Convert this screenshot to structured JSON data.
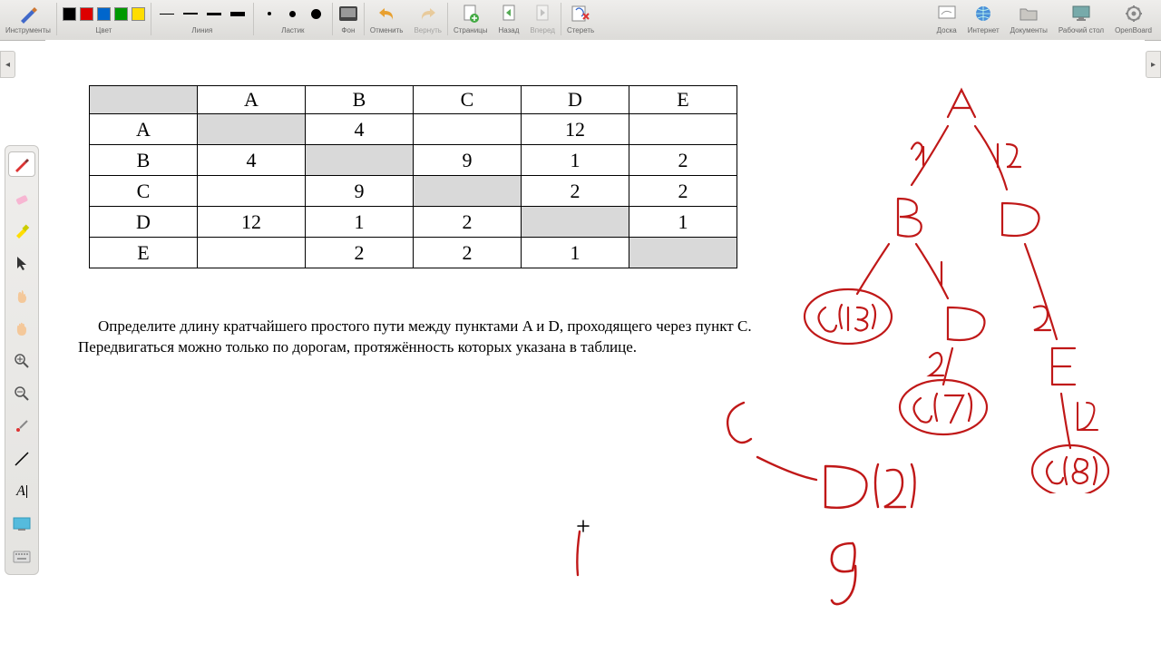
{
  "toolbar": {
    "tools_label": "Инструменты",
    "color_label": "Цвет",
    "line_label": "Линия",
    "eraser_label": "Ластик",
    "bg_label": "Фон",
    "undo_label": "Отменить",
    "redo_label": "Вернуть",
    "pages_label": "Страницы",
    "back_label": "Назад",
    "forward_label": "Вперед",
    "erase_label": "Стереть",
    "board_label": "Доска",
    "internet_label": "Интернет",
    "documents_label": "Документы",
    "desktop_label": "Рабочий стол",
    "openboard_label": "OpenBoard"
  },
  "table": {
    "headers": [
      "",
      "A",
      "B",
      "C",
      "D",
      "E"
    ],
    "rows": [
      {
        "h": "A",
        "c": [
          "",
          "4",
          "",
          "12",
          ""
        ]
      },
      {
        "h": "B",
        "c": [
          "4",
          "",
          "9",
          "1",
          "2"
        ]
      },
      {
        "h": "C",
        "c": [
          "",
          "9",
          "",
          "2",
          "2"
        ]
      },
      {
        "h": "D",
        "c": [
          "12",
          "1",
          "2",
          "",
          "1"
        ]
      },
      {
        "h": "E",
        "c": [
          "",
          "2",
          "2",
          "1",
          ""
        ]
      }
    ]
  },
  "task": {
    "line1": "Определите длину кратчайшего простого пути между пунктами A и D, проходящего через пункт C.",
    "line2": "Передвигаться можно только по дорогам, протяжённость которых указана в таблице."
  },
  "handwriting": {
    "color": "#c01818",
    "tree_nodes": [
      "A",
      "B",
      "D",
      "C(13)",
      "D",
      "C(7)",
      "E",
      "C(8)"
    ],
    "edge_labels": [
      "4",
      "12",
      "1",
      "2",
      "1",
      "2"
    ],
    "extra": [
      "C",
      "D(2)",
      "9"
    ]
  }
}
